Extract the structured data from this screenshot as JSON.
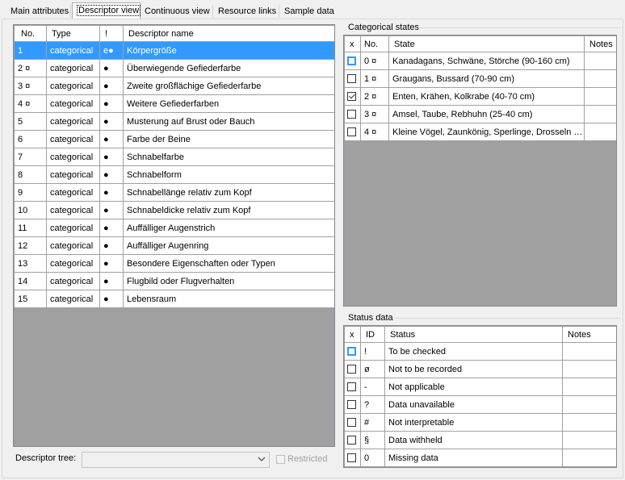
{
  "tabs": [
    "Main attributes",
    "Descriptor view",
    "Continuous view",
    "Resource links",
    "Sample data"
  ],
  "active_tab": 1,
  "descriptors": {
    "columns": [
      "No.",
      "Type",
      "!",
      "Descriptor name"
    ],
    "rows": [
      [
        "1",
        "categorical",
        "e●",
        "Körpergröße"
      ],
      [
        "2 ¤",
        "categorical",
        "●",
        "Überwiegende Gefiederfarbe"
      ],
      [
        "3 ¤",
        "categorical",
        "●",
        "Zweite großflächige Gefiederfarbe"
      ],
      [
        "4 ¤",
        "categorical",
        "●",
        "Weitere Gefiederfarben"
      ],
      [
        "5",
        "categorical",
        "●",
        "Musterung auf Brust oder Bauch"
      ],
      [
        "6",
        "categorical",
        "●",
        "Farbe der Beine"
      ],
      [
        "7",
        "categorical",
        "●",
        "Schnabelfarbe"
      ],
      [
        "8",
        "categorical",
        "●",
        "Schnabelform"
      ],
      [
        "9",
        "categorical",
        "●",
        "Schnabellänge relativ zum Kopf"
      ],
      [
        "10",
        "categorical",
        "●",
        "Schnabeldicke relativ zum Kopf"
      ],
      [
        "11",
        "categorical",
        "●",
        "Auffälliger Augenstrich"
      ],
      [
        "12",
        "categorical",
        "●",
        "Auffälliger Augenring"
      ],
      [
        "13",
        "categorical",
        "●",
        "Besondere Eigenschaften oder Typen"
      ],
      [
        "14",
        "categorical",
        "●",
        "Flugbild oder Flugverhalten"
      ],
      [
        "15",
        "categorical",
        "●",
        "Lebensraum"
      ]
    ],
    "selected_row": 0
  },
  "descriptor_tree": {
    "label": "Descriptor tree:",
    "value": ""
  },
  "restricted_label": "Restricted",
  "categorical_states": {
    "title": "Categorical states",
    "columns": [
      "x",
      "No.",
      "State",
      "Notes"
    ],
    "rows": [
      {
        "checked": false,
        "no": "0 ¤",
        "state": "Kanadagans, Schwäne, Störche (90-160 cm)",
        "notes": ""
      },
      {
        "checked": false,
        "no": "1 ¤",
        "state": "Graugans, Bussard (70-90 cm)",
        "notes": ""
      },
      {
        "checked": true,
        "no": "2 ¤",
        "state": "Enten, Krähen, Kolkrabe (40-70 cm)",
        "notes": ""
      },
      {
        "checked": false,
        "no": "3 ¤",
        "state": "Amsel, Taube, Rebhuhn (25-40 cm)",
        "notes": ""
      },
      {
        "checked": false,
        "no": "4 ¤",
        "state": "Kleine Vögel, Zaunkönig, Sperlinge, Drosseln (...",
        "notes": ""
      }
    ]
  },
  "status_data": {
    "title": "Status data",
    "columns": [
      "x",
      "ID",
      "Status",
      "Notes"
    ],
    "rows": [
      {
        "checked": false,
        "id": "!",
        "status": "To be checked",
        "notes": ""
      },
      {
        "checked": false,
        "id": "ø",
        "status": "Not to be recorded",
        "notes": ""
      },
      {
        "checked": false,
        "id": "-",
        "status": "Not applicable",
        "notes": ""
      },
      {
        "checked": false,
        "id": "?",
        "status": "Data unavailable",
        "notes": ""
      },
      {
        "checked": false,
        "id": "#",
        "status": "Not interpretable",
        "notes": ""
      },
      {
        "checked": false,
        "id": "§",
        "status": "Data withheld",
        "notes": ""
      },
      {
        "checked": false,
        "id": "0",
        "status": "Missing data",
        "notes": ""
      }
    ]
  },
  "colors": {
    "selection": "#3399ff",
    "empty_grid": "#a0a0a0"
  }
}
